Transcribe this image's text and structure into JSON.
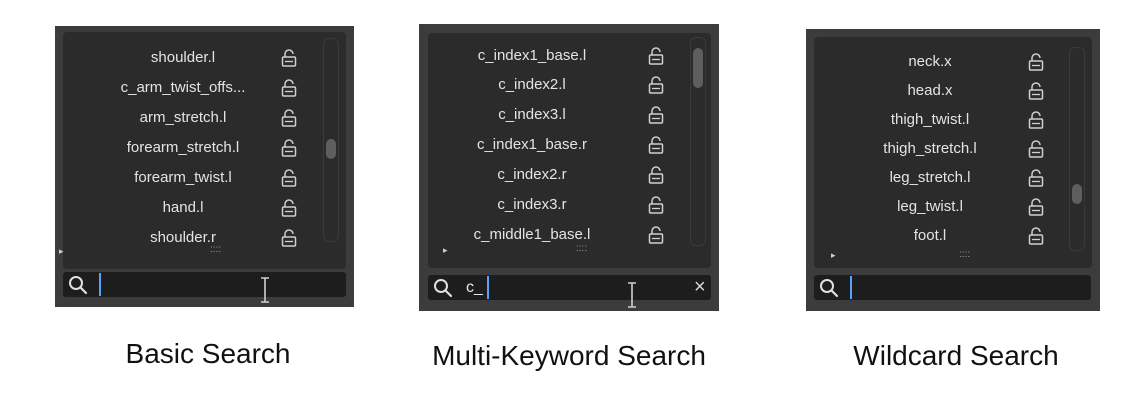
{
  "panels": [
    {
      "caption": "Basic Search",
      "rows": [
        "shoulder.l",
        "c_arm_twist_offs...",
        "arm_stretch.l",
        "forearm_stretch.l",
        "forearm_twist.l",
        "hand.l",
        "shoulder.r"
      ],
      "search_value": "",
      "scroll_position": 0.55
    },
    {
      "caption": "Multi-Keyword Search",
      "rows": [
        "c_index1_base.l",
        "c_index2.l",
        "c_index3.l",
        "c_index1_base.r",
        "c_index2.r",
        "c_index3.r",
        "c_middle1_base.l"
      ],
      "search_value": "c_",
      "scroll_position": 0.05
    },
    {
      "caption": "Wildcard Search",
      "rows": [
        "neck.x",
        "head.x",
        "thigh_twist.l",
        "thigh_stretch.l",
        "leg_stretch.l",
        "leg_twist.l",
        "foot.l"
      ],
      "search_value": "",
      "scroll_position": 0.75
    }
  ],
  "icons": {
    "lock": "unlocked-padlock-icon",
    "search": "magnifier-icon",
    "expand": "▸",
    "grip": "::::",
    "clear": "×"
  },
  "colors": {
    "panel_bg": "#3c3c3c",
    "list_bg": "#2b2b2b",
    "search_bg": "#1d1d1d",
    "caret": "#5aa0ff"
  }
}
